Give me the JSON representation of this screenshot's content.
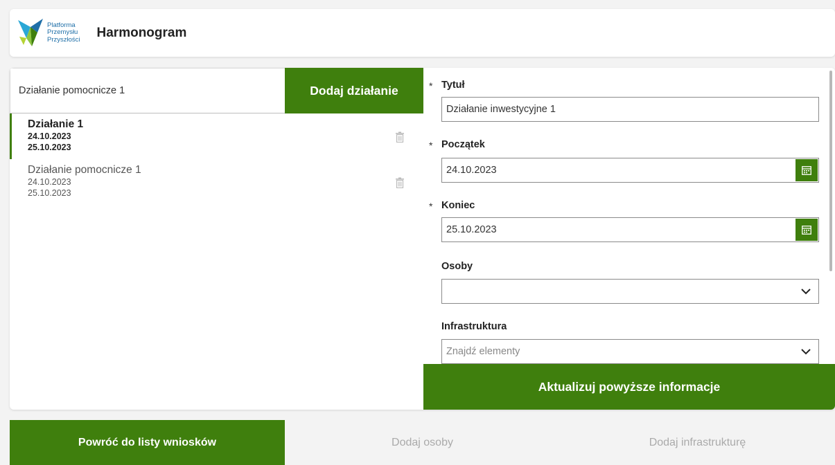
{
  "header": {
    "logo_lines": [
      "Platforma",
      "Przemysłu",
      "Przyszłości"
    ],
    "title": "Harmonogram"
  },
  "left": {
    "new_value": "Działanie pomocnicze 1",
    "add_label": "Dodaj działanie",
    "items": [
      {
        "name": "Działanie 1",
        "start": "24.10.2023",
        "end": "25.10.2023",
        "selected": true
      },
      {
        "name": "Działanie pomocnicze 1",
        "start": "24.10.2023",
        "end": "25.10.2023",
        "selected": false
      }
    ]
  },
  "form": {
    "title_label": "Tytuł",
    "title_value": "Działanie inwestycyjne 1",
    "start_label": "Początek",
    "start_value": "24.10.2023",
    "end_label": "Koniec",
    "end_value": "25.10.2023",
    "persons_label": "Osoby",
    "infra_label": "Infrastruktura",
    "infra_placeholder": "Znajdź elementy",
    "required_mark": "*",
    "update_label": "Aktualizuj powyższe informacje"
  },
  "bottom": {
    "back_label": "Powróć do listy wniosków",
    "add_persons_label": "Dodaj osoby",
    "add_infra_label": "Dodaj infrastrukturę"
  },
  "colors": {
    "accent": "#3f7f0d",
    "logo_text": "#1f6fa8"
  }
}
